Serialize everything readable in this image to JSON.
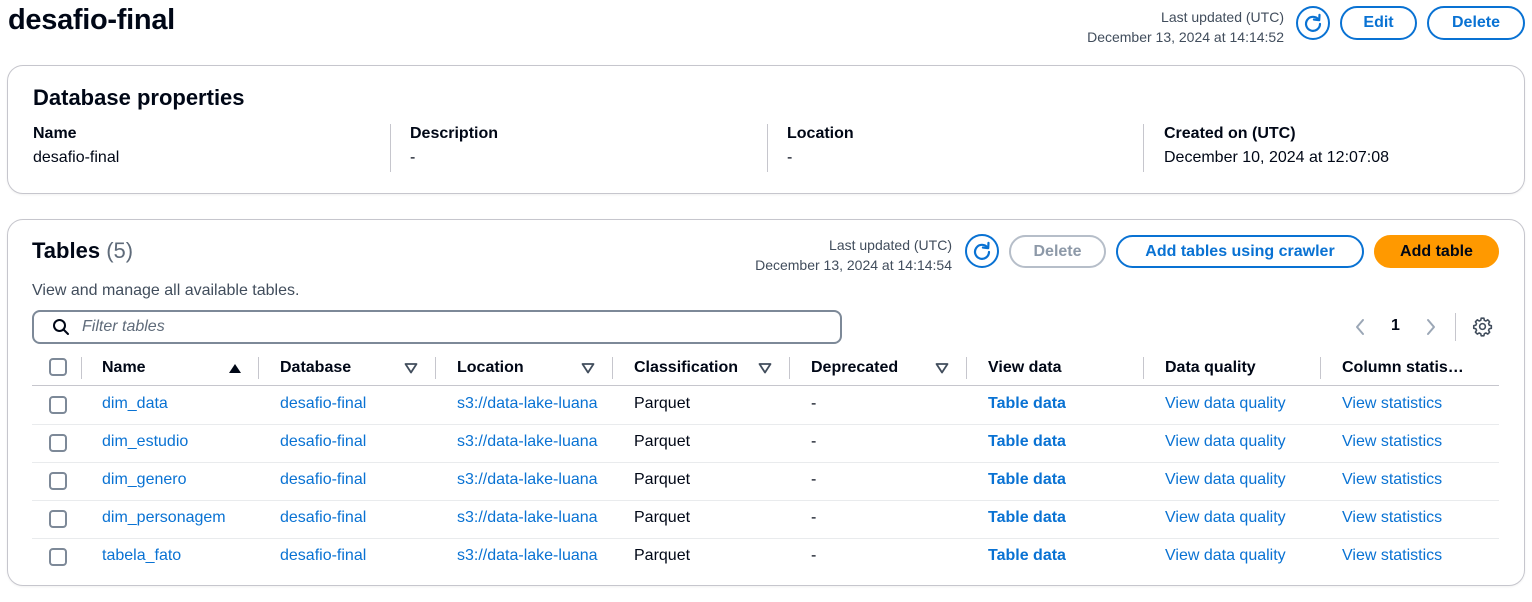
{
  "header": {
    "title": "desafio-final",
    "last_updated_label": "Last updated (UTC)",
    "last_updated_value": "December 13, 2024 at 14:14:52",
    "edit_label": "Edit",
    "delete_label": "Delete"
  },
  "database_properties": {
    "title": "Database properties",
    "fields": [
      {
        "label": "Name",
        "value": "desafio-final"
      },
      {
        "label": "Description",
        "value": "-"
      },
      {
        "label": "Location",
        "value": "-"
      },
      {
        "label": "Created on (UTC)",
        "value": "December 10, 2024 at 12:07:08"
      }
    ]
  },
  "tables": {
    "title": "Tables",
    "count": "(5)",
    "description": "View and manage all available tables.",
    "last_updated_label": "Last updated (UTC)",
    "last_updated_value": "December 13, 2024 at 14:14:54",
    "delete_label": "Delete",
    "add_crawler_label": "Add tables using crawler",
    "add_table_label": "Add table",
    "search_placeholder": "Filter tables",
    "current_page": "1",
    "columns": [
      "Name",
      "Database",
      "Location",
      "Classification",
      "Deprecated",
      "View data",
      "Data quality",
      "Column statis…"
    ],
    "rows": [
      {
        "name": "dim_data",
        "database": "desafio-final",
        "location": "s3://data-lake-luana",
        "classification": "Parquet",
        "deprecated": "-",
        "view_data": "Table data",
        "data_quality": "View data quality",
        "column_stats": "View statistics"
      },
      {
        "name": "dim_estudio",
        "database": "desafio-final",
        "location": "s3://data-lake-luana",
        "classification": "Parquet",
        "deprecated": "-",
        "view_data": "Table data",
        "data_quality": "View data quality",
        "column_stats": "View statistics"
      },
      {
        "name": "dim_genero",
        "database": "desafio-final",
        "location": "s3://data-lake-luana",
        "classification": "Parquet",
        "deprecated": "-",
        "view_data": "Table data",
        "data_quality": "View data quality",
        "column_stats": "View statistics"
      },
      {
        "name": "dim_personagem",
        "database": "desafio-final",
        "location": "s3://data-lake-luana",
        "classification": "Parquet",
        "deprecated": "-",
        "view_data": "Table data",
        "data_quality": "View data quality",
        "column_stats": "View statistics"
      },
      {
        "name": "tabela_fato",
        "database": "desafio-final",
        "location": "s3://data-lake-luana",
        "classification": "Parquet",
        "deprecated": "-",
        "view_data": "Table data",
        "data_quality": "View data quality",
        "column_stats": "View statistics"
      }
    ]
  },
  "colors": {
    "link": "#0972d3",
    "primary_button": "#ff9900",
    "border": "#c6c6cd",
    "text": "#000716"
  },
  "icons": [
    "refresh-icon",
    "search-icon",
    "sort-asc-icon",
    "sort-desc-icon",
    "chevron-left-icon",
    "chevron-right-icon",
    "settings-gear-icon"
  ]
}
